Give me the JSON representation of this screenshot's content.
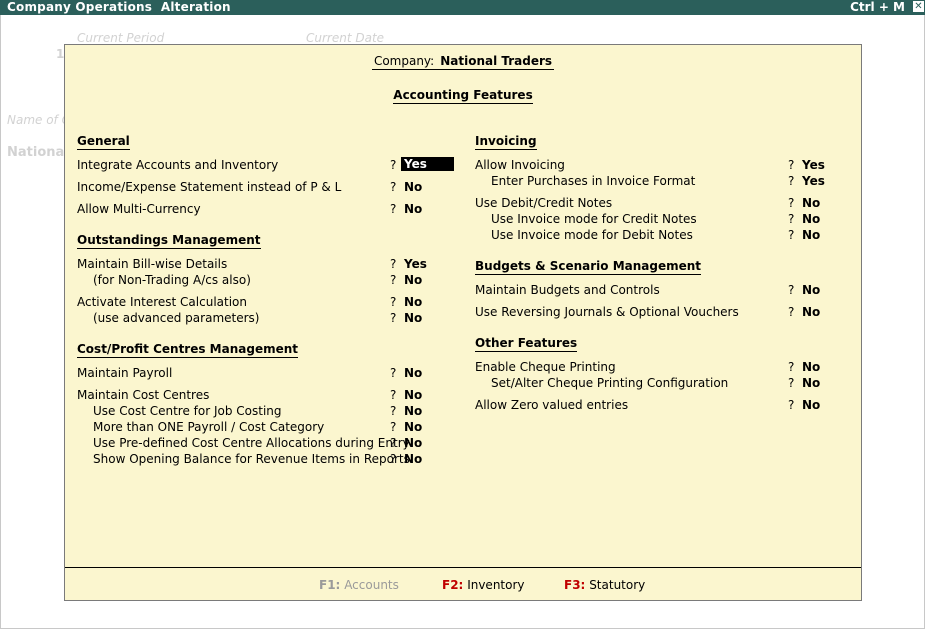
{
  "window": {
    "title": "Company Operations  Alteration",
    "shortcut": "Ctrl + M",
    "close_glyph": "✕"
  },
  "background": {
    "current_period_label": "Current Period",
    "current_date_label": "Current Date",
    "name_label": "Name of C",
    "company_name": "National",
    "digit": "1"
  },
  "dialog": {
    "company_label": "Company:",
    "company_name": "National Traders",
    "title": "Accounting Features"
  },
  "left": {
    "general": {
      "heading": "General",
      "rows": [
        {
          "label": "Integrate Accounts and Inventory",
          "q": "?",
          "value": "Yes",
          "selected": true
        },
        {
          "label": "Income/Expense Statement instead of P & L",
          "q": "?",
          "value": "No"
        },
        {
          "label": "Allow Multi-Currency",
          "q": "?",
          "value": "No"
        }
      ]
    },
    "outstandings": {
      "heading": "Outstandings Management",
      "rows": [
        {
          "label": "Maintain Bill-wise Details",
          "q": "?",
          "value": "Yes"
        },
        {
          "label": "(for Non-Trading A/cs also)",
          "q": "?",
          "value": "No"
        },
        {
          "label": "Activate Interest Calculation",
          "q": "?",
          "value": "No"
        },
        {
          "label": "(use advanced parameters)",
          "q": "?",
          "value": "No"
        }
      ]
    },
    "cost": {
      "heading": "Cost/Profit Centres Management",
      "rows": [
        {
          "label": "Maintain Payroll",
          "q": "?",
          "value": "No"
        },
        {
          "label": "Maintain Cost Centres",
          "q": "?",
          "value": "No"
        },
        {
          "label": "Use Cost Centre for Job Costing",
          "q": "?",
          "value": "No"
        },
        {
          "label": "More than ONE Payroll / Cost Category",
          "q": "?",
          "value": "No"
        },
        {
          "label": "Use Pre-defined Cost Centre Allocations during Entry",
          "q": "?",
          "value": "No"
        },
        {
          "label": "Show Opening Balance for Revenue Items in Reports",
          "q": "?",
          "value": "No"
        }
      ]
    }
  },
  "right": {
    "invoicing": {
      "heading": "Invoicing",
      "rows": [
        {
          "label": "Allow Invoicing",
          "q": "?",
          "value": "Yes"
        },
        {
          "label": "Enter Purchases in Invoice Format",
          "q": "?",
          "value": "Yes"
        },
        {
          "label": "Use Debit/Credit Notes",
          "q": "?",
          "value": "No"
        },
        {
          "label": "Use Invoice mode for Credit Notes",
          "q": "?",
          "value": "No"
        },
        {
          "label": "Use Invoice mode for Debit Notes",
          "q": "?",
          "value": "No"
        }
      ]
    },
    "budgets": {
      "heading": "Budgets & Scenario Management",
      "rows": [
        {
          "label": "Maintain Budgets and Controls",
          "q": "?",
          "value": "No"
        },
        {
          "label": "Use Reversing Journals & Optional Vouchers",
          "q": "?",
          "value": "No"
        }
      ]
    },
    "other": {
      "heading": "Other Features",
      "rows": [
        {
          "label": "Enable Cheque Printing",
          "q": "?",
          "value": "No"
        },
        {
          "label": "Set/Alter Cheque Printing Configuration",
          "q": "?",
          "value": "No"
        },
        {
          "label": "Allow Zero valued entries",
          "q": "?",
          "value": "No"
        }
      ]
    }
  },
  "footer": {
    "f1_key": "F1:",
    "f1_label": "Accounts",
    "f2_key": "F2:",
    "f2_label": "Inventory",
    "f3_key": "F3:",
    "f3_label": "Statutory"
  },
  "colors": {
    "titlebar": "#2b5f5b",
    "dialog_bg": "#fbf6cf",
    "fkey_active": "#c00000",
    "fkey_dim": "#9a9a9a"
  }
}
